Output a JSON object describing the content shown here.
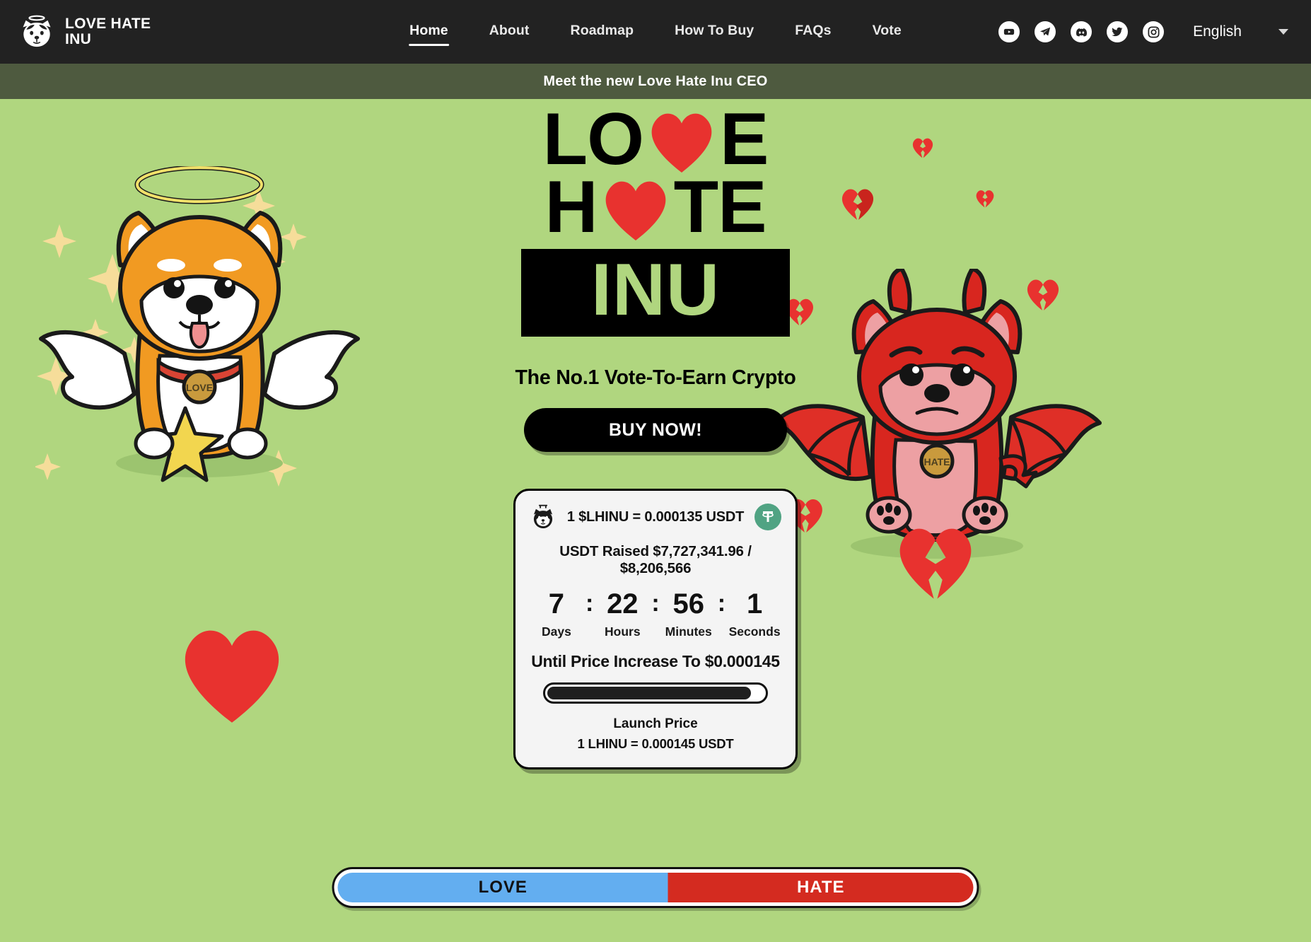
{
  "brand": {
    "name": "LOVE HATE\nINU",
    "logo_icon": "inu-angel-head-icon"
  },
  "nav": {
    "items": [
      {
        "label": "Home",
        "active": true
      },
      {
        "label": "About",
        "active": false
      },
      {
        "label": "Roadmap",
        "active": false
      },
      {
        "label": "How To Buy",
        "active": false
      },
      {
        "label": "FAQs",
        "active": false
      },
      {
        "label": "Vote",
        "active": false
      }
    ]
  },
  "socials": [
    {
      "name": "youtube-icon"
    },
    {
      "name": "telegram-icon"
    },
    {
      "name": "discord-icon"
    },
    {
      "name": "twitter-icon"
    },
    {
      "name": "instagram-icon"
    }
  ],
  "language": {
    "selected": "English",
    "caret_icon": "chevron-down-icon"
  },
  "announcement": {
    "text": "Meet the new Love Hate Inu CEO"
  },
  "hero": {
    "logo_line1_pre": "LO",
    "logo_line1_post": "E",
    "logo_line2_pre": "H",
    "logo_line2_post": "TE",
    "logo_line3": "INU",
    "tagline": "The No.1 Vote-To-Earn Crypto",
    "buy_label": "BUY NOW!"
  },
  "presale": {
    "token_icon": "inu-head-icon",
    "price_line": "1 $LHINU = 0.000135 USDT",
    "usdt_icon": "tether-icon",
    "raised_line": "USDT Raised $7,727,341.96 / $8,206,566",
    "raised_current": "$7,727,341.96",
    "raised_target": "$8,206,566",
    "countdown": {
      "days": "7",
      "hours": "22",
      "minutes": "56",
      "seconds": "1",
      "separator": ":",
      "labels": {
        "days": "Days",
        "hours": "Hours",
        "minutes": "Minutes",
        "seconds": "Seconds"
      }
    },
    "until_text": "Until Price Increase To $0.000145",
    "progress_percent": 94,
    "launch_title": "Launch Price",
    "launch_sub": "1 LHINU = 0.000145 USDT"
  },
  "vote": {
    "love_label": "LOVE",
    "hate_label": "HATE",
    "love_percent": 52,
    "hate_percent": 48
  },
  "colors": {
    "background": "#b0d67f",
    "header": "#222222",
    "announce": "#4e5a3f",
    "heart_red": "#e8322f",
    "love_blue": "#63aef0",
    "hate_red": "#d42b20",
    "card_bg": "#f4f4f4",
    "tether_green": "#50a383"
  }
}
